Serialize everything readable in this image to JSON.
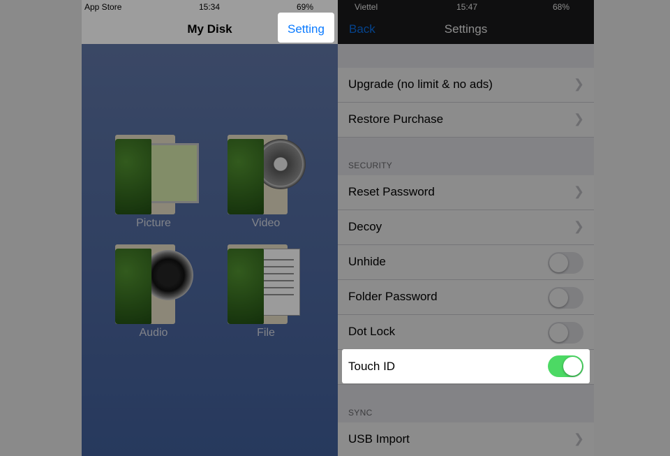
{
  "left": {
    "status": {
      "carrier": "App Store",
      "time": "15:34",
      "battery": "69%"
    },
    "title": "My Disk",
    "setting_button": "Setting",
    "tiles": [
      {
        "label": "Picture",
        "icon": "picture-folder-icon"
      },
      {
        "label": "Video",
        "icon": "video-folder-icon"
      },
      {
        "label": "Audio",
        "icon": "audio-folder-icon"
      },
      {
        "label": "File",
        "icon": "file-folder-icon"
      }
    ]
  },
  "right": {
    "status": {
      "carrier": "Viettel",
      "time": "15:47",
      "battery": "68%"
    },
    "back": "Back",
    "title": "Settings",
    "rows": {
      "upgrade": "Upgrade (no limit & no ads)",
      "restore": "Restore Purchase",
      "security_header": "SECURITY",
      "reset_password": "Reset Password",
      "decoy": "Decoy",
      "unhide": "Unhide",
      "folder_password": "Folder Password",
      "dot_lock": "Dot Lock",
      "touch_id": "Touch ID",
      "sync_header": "SYNC",
      "usb_import": "USB Import"
    },
    "toggles": {
      "unhide": false,
      "folder_password": false,
      "dot_lock": false,
      "touch_id": true
    },
    "accent": "#4cd964"
  }
}
